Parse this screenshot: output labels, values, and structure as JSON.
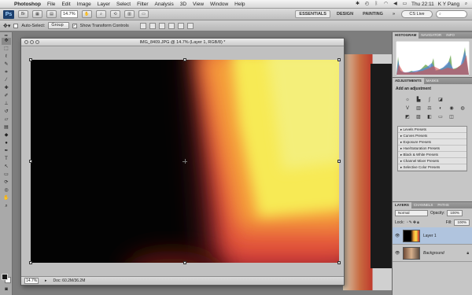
{
  "menubar": {
    "app": "Photoshop",
    "items": [
      "File",
      "Edit",
      "Image",
      "Layer",
      "Select",
      "Filter",
      "Analysis",
      "3D",
      "View",
      "Window",
      "Help"
    ],
    "clock": "Thu 22:11",
    "user": "K Y Pang"
  },
  "appbar": {
    "logo": "Ps",
    "zoom": "14.7%",
    "workspaces": [
      "ESSENTIALS",
      "DESIGN",
      "PAINTING"
    ],
    "more": "»",
    "cs_live": "CS Live"
  },
  "options": {
    "auto_select_label": "Auto-Select:",
    "auto_select_value": "Group",
    "show_transform_label": "Show Transform Controls"
  },
  "document": {
    "title": "IMG_8409.JPG @ 14.7% (Layer 1, RGB/8) *",
    "status_zoom": "14.7%",
    "status_doc": "Doc: 60.2M/36.2M"
  },
  "panels": {
    "histogram_tabs": [
      "HISTOGRAM",
      "NAVIGATOR",
      "INFO"
    ],
    "adjust_tabs": [
      "ADJUSTMENTS",
      "MASKS"
    ],
    "adjust_title": "Add an adjustment",
    "presets": [
      "Levels Presets",
      "Curves Presets",
      "Exposure Presets",
      "Hue/Saturation Presets",
      "Black & White Presets",
      "Channel Mixer Presets",
      "Selective Color Presets"
    ],
    "layers_tabs": [
      "LAYERS",
      "CHANNELS",
      "PATHS"
    ],
    "blend_mode": "Normal",
    "opacity_label": "Opacity:",
    "opacity_value": "100%",
    "lock_label": "Lock:",
    "fill_label": "Fill:",
    "fill_value": "100%",
    "layers": [
      {
        "name": "Layer 1",
        "visible": true
      },
      {
        "name": "Background",
        "visible": true
      }
    ]
  },
  "colors": {
    "image_dark": "#030303",
    "glow_orange": "#f6a23a",
    "glow_yellow": "#f7ea55",
    "glow_red": "#c9303a"
  }
}
